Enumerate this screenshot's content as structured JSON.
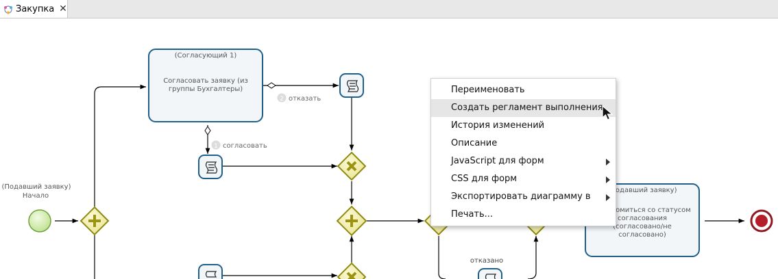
{
  "tab": {
    "title": "Закупка",
    "icon": "bpmn-process-icon",
    "close": "✕"
  },
  "diagram": {
    "task_approve": {
      "role": "(Согласующий 1)",
      "name": "Согласовать заявку (из группы Бухгалтеры)"
    },
    "task_notify": {
      "role": "(Подавший заявку)",
      "name": "Ознакомиться со статусом согласования (согласовано/не согласовано)"
    },
    "start_event": {
      "role": "(Подавший заявку)",
      "name": "Начало"
    },
    "flow_reject": {
      "order": "2",
      "label": "отказать"
    },
    "flow_approve": {
      "order": "1",
      "label": "согласовать"
    },
    "flow_rejected": {
      "label": "отказано"
    }
  },
  "context_menu": {
    "items": [
      {
        "label": "Переименовать",
        "submenu": false,
        "highlighted": false
      },
      {
        "label": "Создать регламент выполнения",
        "submenu": false,
        "highlighted": true
      },
      {
        "label": "История изменений",
        "submenu": false,
        "highlighted": false
      },
      {
        "label": "Описание",
        "submenu": false,
        "highlighted": false
      },
      {
        "label": "JavaScript для форм",
        "submenu": true,
        "highlighted": false
      },
      {
        "label": "CSS для форм",
        "submenu": true,
        "highlighted": false
      },
      {
        "label": "Экспортировать диаграмму в",
        "submenu": true,
        "highlighted": false
      },
      {
        "label": "Печать...",
        "submenu": false,
        "highlighted": false
      }
    ]
  },
  "colors": {
    "task_border": "#1f5f8b",
    "task_fill": "#f3f6f9",
    "gateway_fill": "#f3f1b0",
    "gateway_stroke": "#8e8a12",
    "start_fill": "#d7eeb5",
    "end_fill": "#b51d2a"
  }
}
